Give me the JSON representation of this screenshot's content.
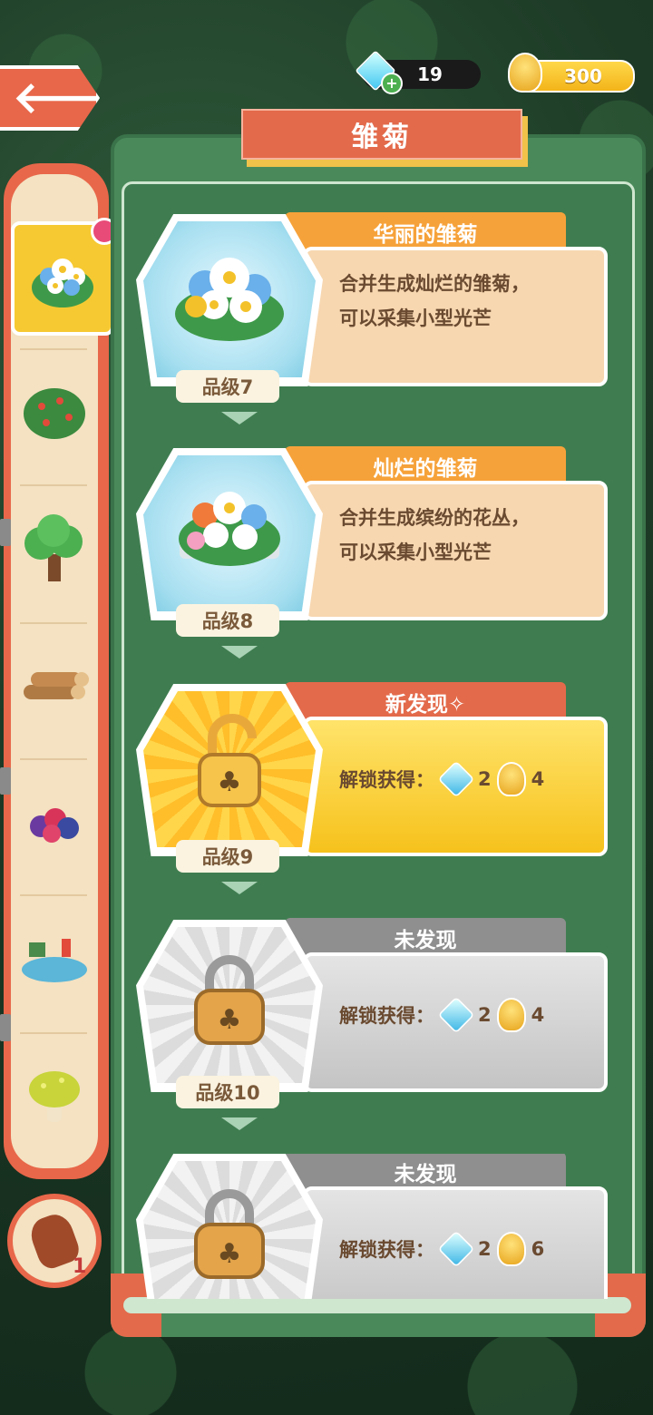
{
  "header": {
    "title": "雏菊",
    "gems": "19",
    "gold": "300"
  },
  "entries": [
    {
      "tag": "华丽的雏菊",
      "desc_line1": "合并生成灿烂的雏菊，",
      "desc_line2": "可以采集小型光芒",
      "grade": "品级7",
      "state": "discovered"
    },
    {
      "tag": "灿烂的雏菊",
      "desc_line1": "合并生成缤纷的花丛，",
      "desc_line2": "可以采集小型光芒",
      "grade": "品级8",
      "state": "discovered"
    },
    {
      "tag": "新发现✧",
      "reward_label": "解锁获得：",
      "gem_count": "2",
      "gold_count": "4",
      "grade": "品级9",
      "state": "new"
    },
    {
      "tag": "未发现",
      "reward_label": "解锁获得：",
      "gem_count": "2",
      "gold_count": "4",
      "grade": "品级10",
      "state": "locked"
    },
    {
      "tag": "未发现",
      "reward_label": "解锁获得：",
      "gem_count": "2",
      "gold_count": "6",
      "grade": "",
      "state": "locked"
    }
  ],
  "sidebar": {
    "items": [
      "flower-bouquet-icon",
      "fruit-bush-icon",
      "tree-icon",
      "wood-logs-icon",
      "berries-icon",
      "pond-icon",
      "mushroom-icon"
    ]
  },
  "hint": {
    "count": "1"
  },
  "colors": {
    "accent": "#e36a4b",
    "panel": "#4a8a5a",
    "gold": "#f6c21c"
  }
}
